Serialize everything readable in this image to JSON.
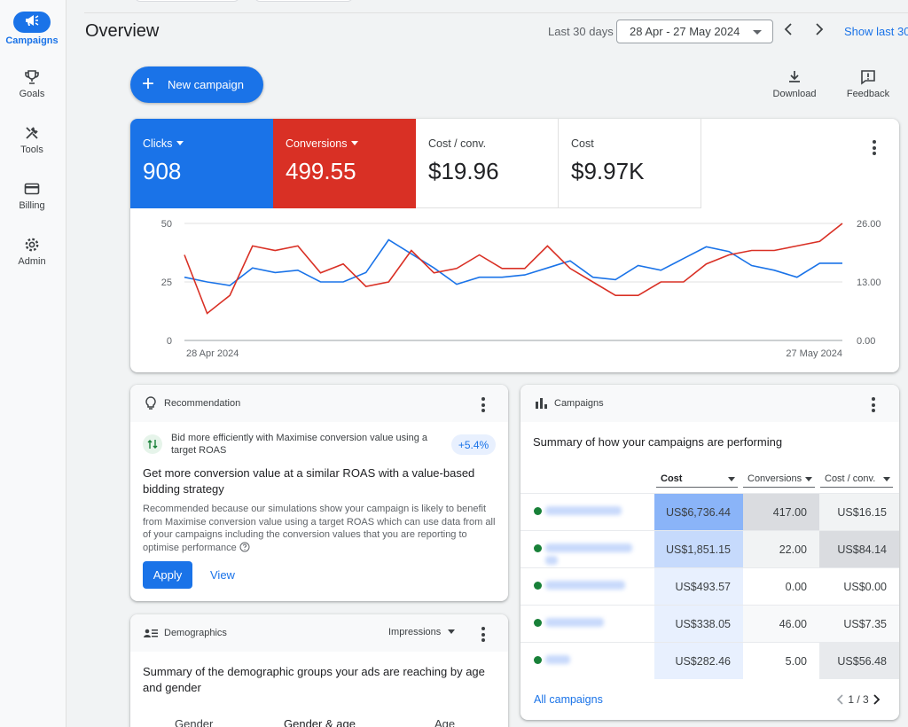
{
  "nav": [
    {
      "label": "Campaigns",
      "icon": "megaphone-icon",
      "active": true
    },
    {
      "label": "Goals",
      "icon": "trophy-icon"
    },
    {
      "label": "Tools",
      "icon": "tools-icon"
    },
    {
      "label": "Billing",
      "icon": "credit-card-icon"
    },
    {
      "label": "Admin",
      "icon": "gear-icon"
    }
  ],
  "header": {
    "title": "Overview",
    "range_label": "Last 30 days",
    "date_range": "28 Apr - 27 May 2024",
    "show_last": "Show last 30"
  },
  "actions": {
    "new_campaign": "New campaign",
    "download": "Download",
    "feedback": "Feedback"
  },
  "metrics": [
    {
      "name": "Clicks",
      "value": "908",
      "color": "#1a73e8",
      "dropdown": true
    },
    {
      "name": "Conversions",
      "value": "499.55",
      "color": "#d93025",
      "dropdown": true
    },
    {
      "name": "Cost / conv.",
      "value": "$19.96"
    },
    {
      "name": "Cost",
      "value": "$9.97K"
    }
  ],
  "chart_data": {
    "type": "line",
    "x_start_label": "28 Apr 2024",
    "x_end_label": "27 May 2024",
    "y_left_ticks": [
      "0",
      "25",
      "50"
    ],
    "y_right_ticks": [
      "0.00",
      "13.00",
      "26.00"
    ],
    "ylim_left": [
      0,
      50
    ],
    "ylim_right": [
      0,
      26
    ],
    "grid": true,
    "series": [
      {
        "name": "Clicks",
        "axis": "left",
        "color": "#1a73e8",
        "values": [
          27,
          25,
          23.5,
          31,
          29,
          30,
          25,
          25,
          29,
          43,
          37,
          31,
          24,
          27,
          27,
          28,
          31,
          34,
          27,
          26,
          32,
          30,
          35,
          40,
          38,
          32,
          30,
          27,
          33,
          33
        ]
      },
      {
        "name": "Conversions",
        "axis": "right",
        "color": "#d93025",
        "values": [
          19,
          6,
          10,
          21,
          20,
          21,
          15,
          17,
          12,
          13,
          20,
          15,
          16,
          19,
          16,
          16,
          21,
          16,
          13,
          10,
          10,
          13,
          13,
          17,
          19,
          20,
          20,
          21,
          22,
          26
        ]
      }
    ]
  },
  "recommendation": {
    "header": "Recommendation",
    "suggestion": "Bid more efficiently with Maximise conversion value using a target ROAS",
    "chip": "+5.4%",
    "title": "Get more conversion value at a similar ROAS with a value-based bidding strategy",
    "body": "Recommended because our simulations show your campaign is likely to benefit from Maximise conversion value using a target ROAS which can use data from all of your campaigns including the conversion values that you are reporting to optimise performance",
    "apply": "Apply",
    "view": "View"
  },
  "campaigns": {
    "header": "Campaigns",
    "summary": "Summary of how your campaigns are performing",
    "columns": [
      "Cost",
      "Conversions",
      "Cost / conv."
    ],
    "rows": [
      {
        "cost": "US$6,736.44",
        "conversions": "417.00",
        "cost_conv": "US$16.15"
      },
      {
        "cost": "US$1,851.15",
        "conversions": "22.00",
        "cost_conv": "US$84.14"
      },
      {
        "cost": "US$493.57",
        "conversions": "0.00",
        "cost_conv": "US$0.00"
      },
      {
        "cost": "US$338.05",
        "conversions": "46.00",
        "cost_conv": "US$7.35"
      },
      {
        "cost": "US$282.46",
        "conversions": "5.00",
        "cost_conv": "US$56.48"
      }
    ],
    "all_link": "All campaigns",
    "page": "1 / 3"
  },
  "demographics": {
    "header": "Demographics",
    "selector": "Impressions",
    "summary": "Summary of the demographic groups your ads are reaching by age and gender",
    "tabs": [
      "Gender",
      "Gender & age",
      "Age"
    ]
  }
}
